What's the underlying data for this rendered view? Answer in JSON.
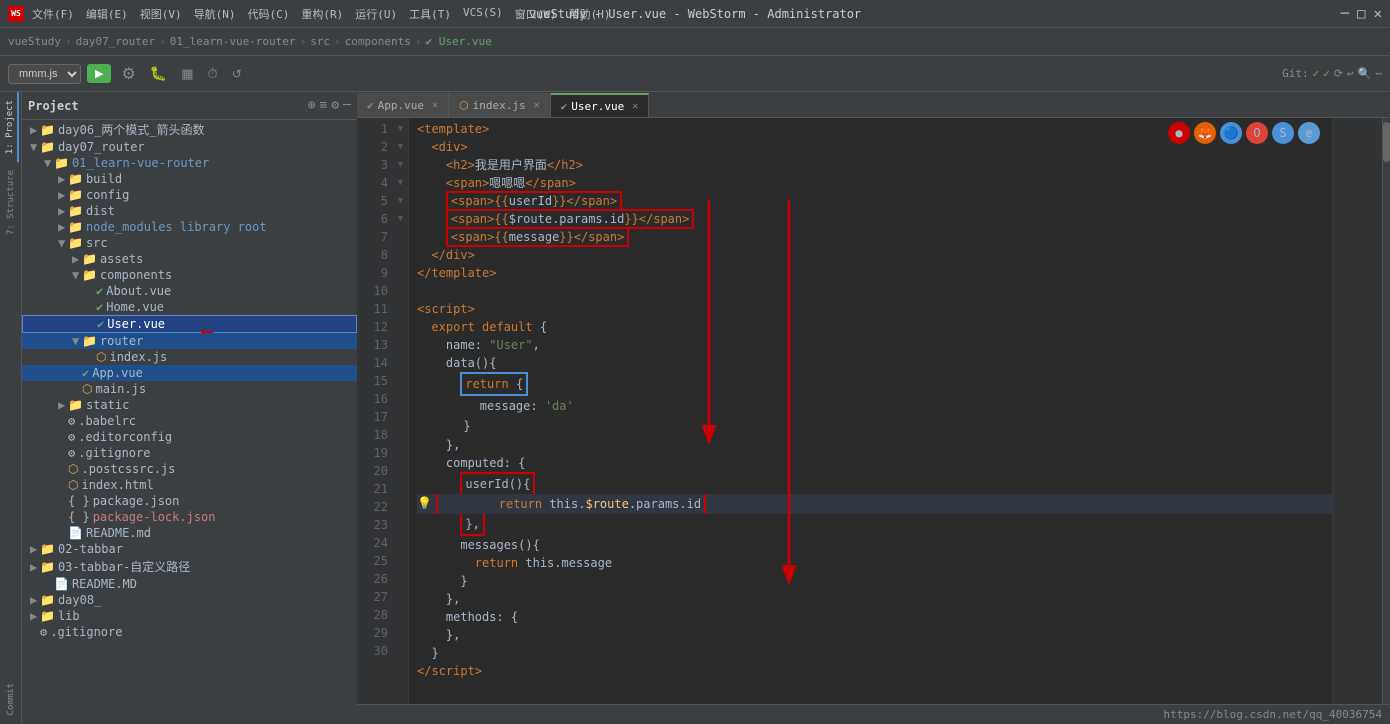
{
  "titlebar": {
    "logo": "WS",
    "menus": [
      "文件(F)",
      "编辑(E)",
      "视图(V)",
      "导航(N)",
      "代码(C)",
      "重构(R)",
      "运行(U)",
      "工具(T)",
      "VCS(S)",
      "窗口(W)",
      "帮助(H)"
    ],
    "title": "vueStudy - User.vue - WebStorm - Administrator",
    "controls": [
      "─",
      "□",
      "✕"
    ]
  },
  "breadcrumb": {
    "items": [
      "vueStudy",
      "day07_router",
      "01_learn-vue-router",
      "src",
      "components"
    ],
    "current_file": "User.vue"
  },
  "toolbar": {
    "file_selector": "mmm.js",
    "git_label": "Git:",
    "run_icon": "▶",
    "git_check1": "✓",
    "git_check2": "✓"
  },
  "tabs": {
    "items": [
      {
        "label": "App.vue",
        "type": "vue",
        "active": false
      },
      {
        "label": "index.js",
        "type": "js",
        "active": false
      },
      {
        "label": "User.vue",
        "type": "vue",
        "active": true
      }
    ]
  },
  "file_tree": {
    "items": [
      {
        "id": "project",
        "label": "Project",
        "indent": 0,
        "type": "header"
      },
      {
        "id": "day06",
        "label": "day06_两个模式_箭头函数",
        "indent": 1,
        "type": "folder",
        "expanded": false
      },
      {
        "id": "day07",
        "label": "day07_router",
        "indent": 1,
        "type": "folder",
        "expanded": true
      },
      {
        "id": "01learn",
        "label": "01_learn-vue-router",
        "indent": 2,
        "type": "folder",
        "expanded": true,
        "highlight": true
      },
      {
        "id": "build",
        "label": "build",
        "indent": 3,
        "type": "folder",
        "expanded": false
      },
      {
        "id": "config",
        "label": "config",
        "indent": 3,
        "type": "folder",
        "expanded": false
      },
      {
        "id": "dist",
        "label": "dist",
        "indent": 3,
        "type": "folder",
        "expanded": false
      },
      {
        "id": "node_modules",
        "label": "node_modules  library root",
        "indent": 3,
        "type": "folder",
        "expanded": false,
        "highlight": true
      },
      {
        "id": "src",
        "label": "src",
        "indent": 3,
        "type": "folder",
        "expanded": true
      },
      {
        "id": "assets",
        "label": "assets",
        "indent": 4,
        "type": "folder",
        "expanded": false
      },
      {
        "id": "components",
        "label": "components",
        "indent": 4,
        "type": "folder",
        "expanded": true
      },
      {
        "id": "about",
        "label": "About.vue",
        "indent": 5,
        "type": "vue"
      },
      {
        "id": "home",
        "label": "Home.vue",
        "indent": 5,
        "type": "vue"
      },
      {
        "id": "user",
        "label": "User.vue",
        "indent": 5,
        "type": "vue",
        "selected": true
      },
      {
        "id": "router",
        "label": "router",
        "indent": 4,
        "type": "folder",
        "expanded": true
      },
      {
        "id": "indexjs",
        "label": "index.js",
        "indent": 5,
        "type": "js"
      },
      {
        "id": "appvue",
        "label": "App.vue",
        "indent": 4,
        "type": "vue",
        "active_blue": true
      },
      {
        "id": "mainjs",
        "label": "main.js",
        "indent": 4,
        "type": "js"
      },
      {
        "id": "static",
        "label": "static",
        "indent": 3,
        "type": "folder",
        "expanded": false
      },
      {
        "id": "babelrc",
        "label": ".babelrc",
        "indent": 3,
        "type": "config"
      },
      {
        "id": "editorconfig",
        "label": ".editorconfig",
        "indent": 3,
        "type": "config"
      },
      {
        "id": "gitignore",
        "label": ".gitignore",
        "indent": 3,
        "type": "config"
      },
      {
        "id": "postcss",
        "label": ".postcssrc.js",
        "indent": 3,
        "type": "js"
      },
      {
        "id": "indexhtml",
        "label": "index.html",
        "indent": 3,
        "type": "html"
      },
      {
        "id": "packagejson",
        "label": "package.json",
        "indent": 3,
        "type": "json"
      },
      {
        "id": "packagelock",
        "label": "package-lock.json",
        "indent": 3,
        "type": "json",
        "highlight_red": true
      },
      {
        "id": "readme",
        "label": "README.md",
        "indent": 3,
        "type": "md"
      },
      {
        "id": "tabbar02",
        "label": "02-tabbar",
        "indent": 1,
        "type": "folder",
        "expanded": false
      },
      {
        "id": "tabbar03",
        "label": "03-tabbar-自定义路径",
        "indent": 1,
        "type": "folder",
        "expanded": false
      },
      {
        "id": "readmemd",
        "label": "README.MD",
        "indent": 2,
        "type": "md"
      },
      {
        "id": "day08",
        "label": "day08_",
        "indent": 1,
        "type": "folder",
        "expanded": false
      },
      {
        "id": "lib",
        "label": "lib",
        "indent": 1,
        "type": "folder",
        "expanded": false
      },
      {
        "id": "gitignore2",
        "label": ".gitignore",
        "indent": 1,
        "type": "config"
      }
    ]
  },
  "code": {
    "lines": [
      {
        "n": 1,
        "fold": true,
        "content": "&lt;template&gt;",
        "class": "kw"
      },
      {
        "n": 2,
        "fold": false,
        "content": "  &lt;div&gt;"
      },
      {
        "n": 3,
        "fold": false,
        "content": "    &lt;h2&gt;我是用户界面&lt;/h2&gt;"
      },
      {
        "n": 4,
        "fold": false,
        "content": "    &lt;span&gt;嗯嗯嗯&lt;/span&gt;"
      },
      {
        "n": 5,
        "fold": false,
        "content": "    &lt;span&gt;{{userId}}&lt;/span&gt;",
        "box": "red"
      },
      {
        "n": 6,
        "fold": false,
        "content": "    &lt;span&gt;{{$route.params.id}}&lt;/span&gt;",
        "box": "red"
      },
      {
        "n": 7,
        "fold": false,
        "content": "    &lt;span&gt;{{message}}&lt;/span&gt;",
        "box": "red"
      },
      {
        "n": 8,
        "fold": false,
        "content": "  &lt;/div&gt;"
      },
      {
        "n": 9,
        "fold": true,
        "content": "&lt;/template&gt;"
      },
      {
        "n": 10,
        "fold": false,
        "content": ""
      },
      {
        "n": 11,
        "fold": true,
        "content": "&lt;script&gt;"
      },
      {
        "n": 12,
        "fold": false,
        "content": "  export default {"
      },
      {
        "n": 13,
        "fold": false,
        "content": "    name: &quot;User&quot;,"
      },
      {
        "n": 14,
        "fold": false,
        "content": "    data(){"
      },
      {
        "n": 15,
        "fold": false,
        "content": "      return {",
        "box": "blue_start"
      },
      {
        "n": 16,
        "fold": false,
        "content": "        message: 'da'",
        "box": "blue_mid"
      },
      {
        "n": 17,
        "fold": false,
        "content": "      }",
        "box": "blue_end"
      },
      {
        "n": 18,
        "fold": false,
        "content": "    },"
      },
      {
        "n": 19,
        "fold": false,
        "content": "    computed: {"
      },
      {
        "n": 20,
        "fold": false,
        "content": "      userId(){",
        "box": "red2_start"
      },
      {
        "n": 21,
        "fold": false,
        "content": "        return this.$route.params.id",
        "box": "red2_mid",
        "highlight": true,
        "yellow_icon": true
      },
      {
        "n": 22,
        "fold": false,
        "content": "      },",
        "box": "red2_end"
      },
      {
        "n": 23,
        "fold": false,
        "content": "      messages(){"
      },
      {
        "n": 24,
        "fold": false,
        "content": "        return this.message"
      },
      {
        "n": 25,
        "fold": false,
        "content": "      }"
      },
      {
        "n": 26,
        "fold": false,
        "content": "    },"
      },
      {
        "n": 27,
        "fold": false,
        "content": "    methods: {"
      },
      {
        "n": 28,
        "fold": false,
        "content": "    },"
      },
      {
        "n": 29,
        "fold": false,
        "content": "  }"
      },
      {
        "n": 30,
        "fold": true,
        "content": "&lt;/script&gt;"
      }
    ]
  },
  "status_bar": {
    "url": "https://blog.csdn.net/qq_40036754"
  },
  "browser_icons": [
    "🔴",
    "🦊",
    "🔵",
    "🔴2",
    "🔵2",
    "🔵3"
  ],
  "colors": {
    "accent": "#4a90d9",
    "vue_green": "#6a9f6a",
    "js_yellow": "#d4a84b",
    "red": "#c00000",
    "selected_bg": "#214283",
    "active_tab_bg": "#2b2b2b"
  }
}
